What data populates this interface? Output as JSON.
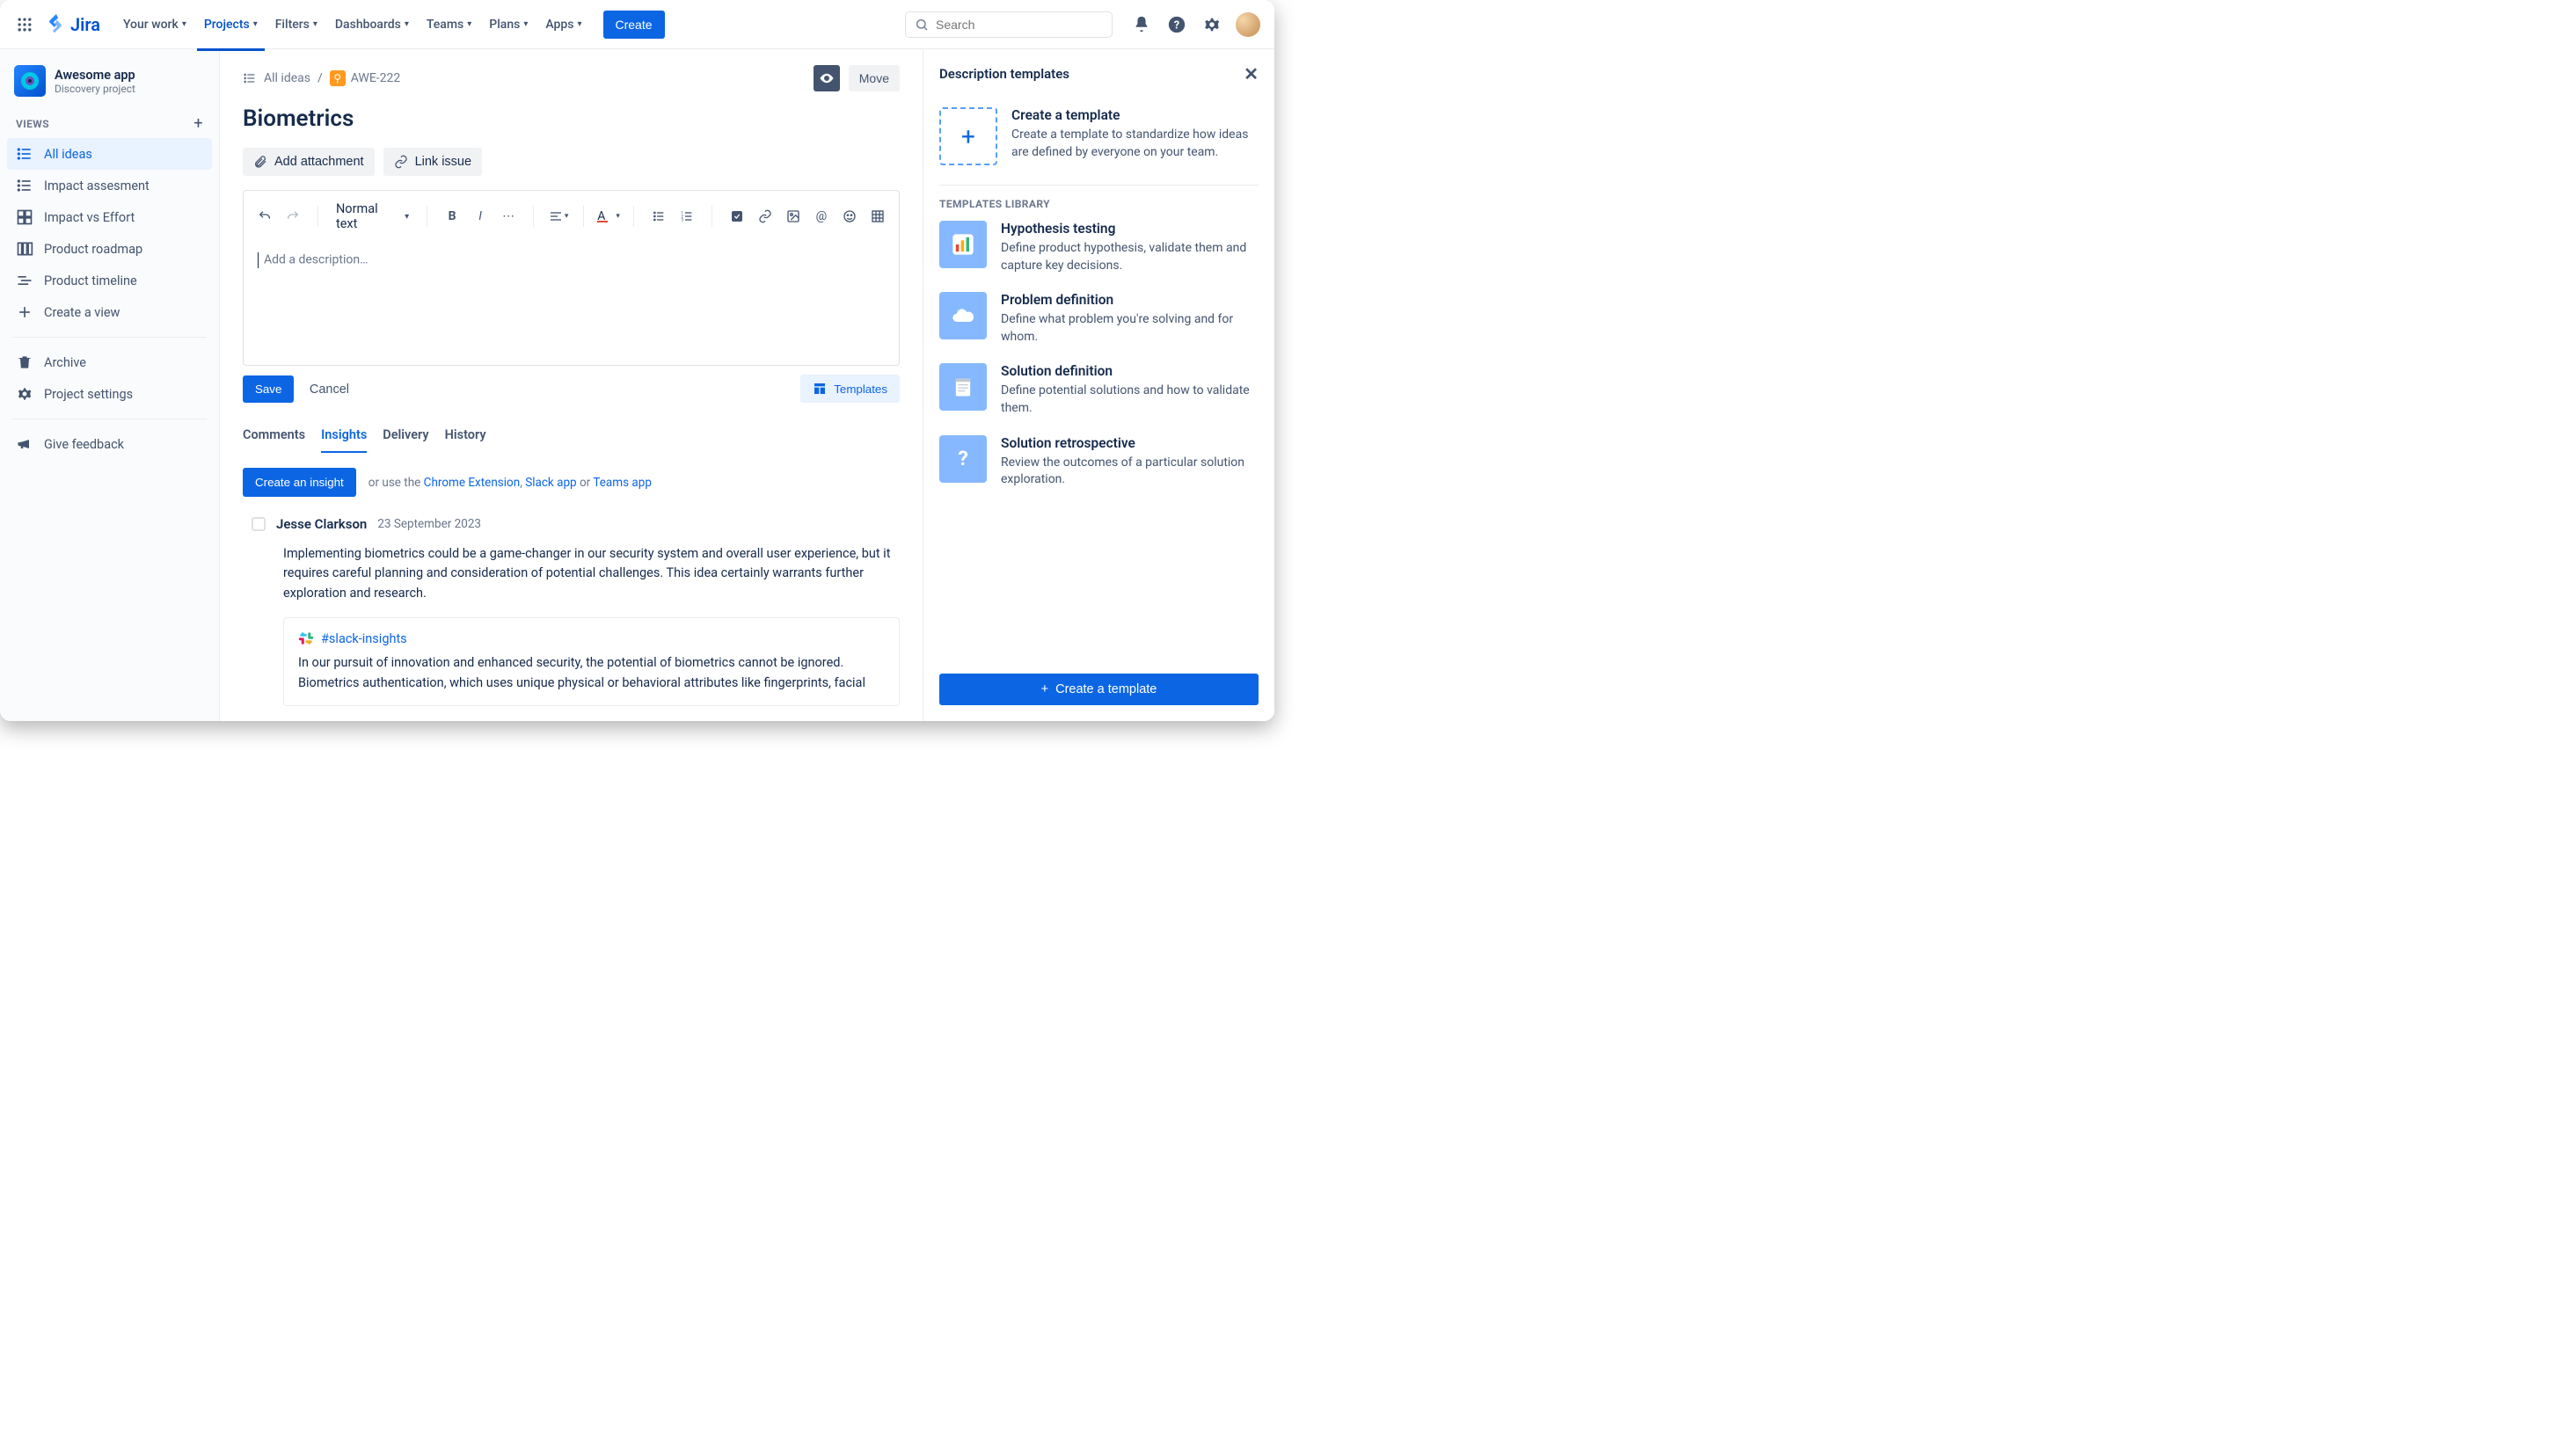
{
  "topbar": {
    "logo_text": "Jira",
    "nav": [
      "Your work",
      "Projects",
      "Filters",
      "Dashboards",
      "Teams",
      "Plans",
      "Apps"
    ],
    "active_nav_index": 1,
    "create": "Create",
    "search_placeholder": "Search"
  },
  "sidebar": {
    "project_name": "Awesome app",
    "project_sub": "Discovery project",
    "views_label": "VIEWS",
    "items": [
      {
        "label": "All ideas",
        "active": true
      },
      {
        "label": "Impact assesment"
      },
      {
        "label": "Impact vs Effort"
      },
      {
        "label": "Product roadmap"
      },
      {
        "label": "Product timeline"
      },
      {
        "label": "Create a view"
      }
    ],
    "archive": "Archive",
    "settings": "Project settings",
    "feedback": "Give feedback"
  },
  "breadcrumb": {
    "root": "All ideas",
    "key": "AWE-222",
    "move": "Move"
  },
  "issue": {
    "title": "Biometrics",
    "add_attachment": "Add attachment",
    "link_issue": "Link issue"
  },
  "editor": {
    "text_style": "Normal text",
    "placeholder": "Add a description…",
    "save": "Save",
    "cancel": "Cancel",
    "templates": "Templates"
  },
  "tabs": [
    "Comments",
    "Insights",
    "Delivery",
    "History"
  ],
  "active_tab_index": 1,
  "insights": {
    "create_button": "Create an insight",
    "or_use": "or use the ",
    "ext1": "Chrome Extension",
    "sep1": ", ",
    "ext2": "Slack app",
    "sep2": " or ",
    "ext3": "Teams app",
    "item": {
      "author": "Jesse Clarkson",
      "date": "23 September 2023",
      "body": "Implementing biometrics could be a game-changer in our security system and overall user experience, but it requires careful planning and consideration of potential challenges. This idea certainly warrants further exploration and research.",
      "slack_channel": "#slack-insights",
      "slack_body": "In our pursuit of innovation and enhanced security, the potential of biometrics cannot be ignored. Biometrics authentication, which uses unique physical or behavioral attributes like fingerprints, facial"
    }
  },
  "right_panel": {
    "title": "Description templates",
    "create_title": "Create a template",
    "create_desc": "Create a template to standardize how ideas are defined by everyone on your team.",
    "library_label": "TEMPLATES LIBRARY",
    "templates": [
      {
        "title": "Hypothesis testing",
        "desc": "Define product hypothesis, validate them and capture key decisions."
      },
      {
        "title": "Problem definition",
        "desc": "Define what problem you're solving and for whom."
      },
      {
        "title": "Solution definition",
        "desc": "Define potential solutions and how to validate them."
      },
      {
        "title": "Solution retrospective",
        "desc": "Review the outcomes of a particular solution exploration."
      }
    ],
    "footer_button": "Create a template"
  }
}
